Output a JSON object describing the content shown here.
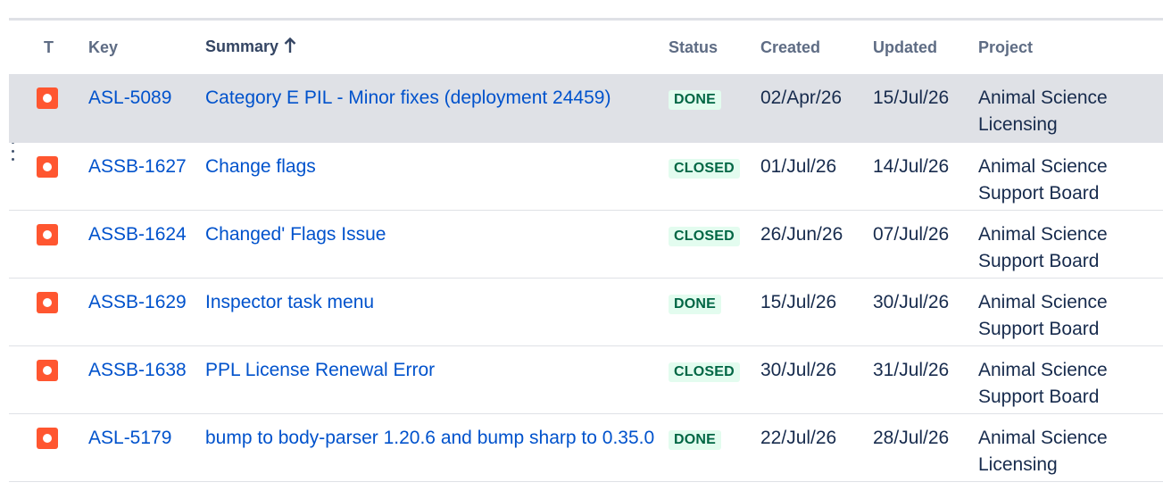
{
  "columns": {
    "type": "T",
    "key": "Key",
    "summary": "Summary",
    "status": "Status",
    "created": "Created",
    "updated": "Updated",
    "project": "Project"
  },
  "sort": {
    "column": "summary",
    "direction": "ascending",
    "icon": "arrow-up-icon"
  },
  "colors": {
    "link": "#0052cc",
    "status_bg": "#e3fcef",
    "status_text": "#006644",
    "bug_icon": "#ff5630",
    "selected_row": "#dfe1e6"
  },
  "rows": [
    {
      "type_icon": "bug-icon",
      "key": "ASL-5089",
      "summary": "Category E PIL - Minor fixes (deployment 24459)",
      "status": "DONE",
      "created": "02/Apr/26",
      "updated": "15/Jul/26",
      "project": "Animal Science Licensing",
      "selected": true
    },
    {
      "type_icon": "bug-icon",
      "key": "ASSB-1627",
      "summary": "Change flags",
      "status": "CLOSED",
      "created": "01/Jul/26",
      "updated": "14/Jul/26",
      "project": "Animal Science Support Board",
      "selected": false
    },
    {
      "type_icon": "bug-icon",
      "key": "ASSB-1624",
      "summary": "Changed' Flags Issue",
      "status": "CLOSED",
      "created": "26/Jun/26",
      "updated": "07/Jul/26",
      "project": "Animal Science Support Board",
      "selected": false
    },
    {
      "type_icon": "bug-icon",
      "key": "ASSB-1629",
      "summary": "Inspector task menu",
      "status": "DONE",
      "created": "15/Jul/26",
      "updated": "30/Jul/26",
      "project": "Animal Science Support Board",
      "selected": false
    },
    {
      "type_icon": "bug-icon",
      "key": "ASSB-1638",
      "summary": "PPL License Renewal Error",
      "status": "CLOSED",
      "created": "30/Jul/26",
      "updated": "31/Jul/26",
      "project": "Animal Science Support Board",
      "selected": false
    },
    {
      "type_icon": "bug-icon",
      "key": "ASL-5179",
      "summary": "bump to body-parser 1.20.6 and bump sharp to 0.35.0",
      "status": "DONE",
      "created": "22/Jul/26",
      "updated": "28/Jul/26",
      "project": "Animal Science Licensing",
      "selected": false
    }
  ]
}
